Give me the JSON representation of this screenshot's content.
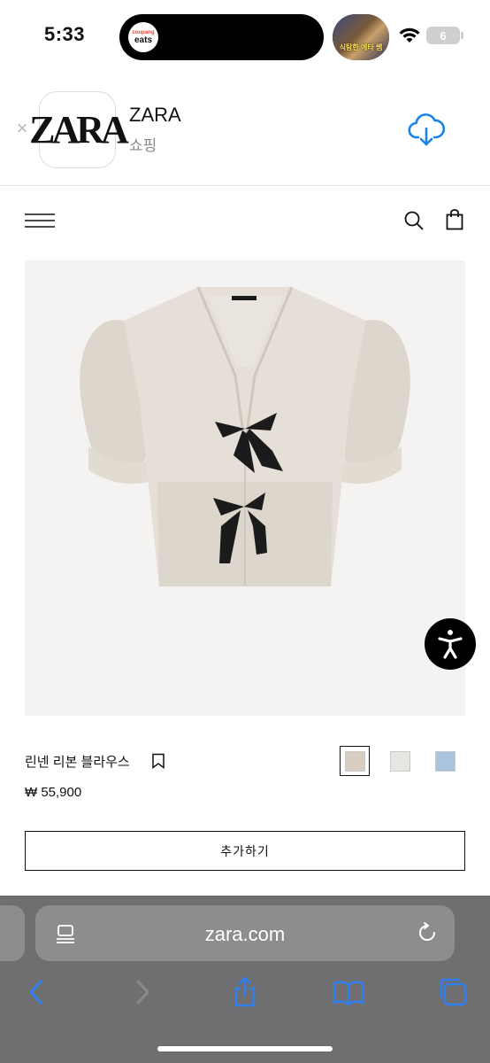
{
  "status_bar": {
    "time": "5:33",
    "island_app_line1": "coupang",
    "island_app_line2": "eats",
    "pip_caption": "식탐한 에타 쌤",
    "battery_level": "6"
  },
  "app_banner": {
    "icon_text": "ZARA",
    "app_name": "ZARA",
    "category": "쇼핑"
  },
  "product": {
    "name": "린넨 리본 블라우스",
    "price": "₩ 55,900",
    "add_button_label": "추가하기",
    "colors": [
      {
        "hex": "#d9ccc0",
        "selected": true
      },
      {
        "hex": "#e8e6e3",
        "selected": false
      },
      {
        "hex": "#aac4e0",
        "selected": false
      }
    ]
  },
  "browser": {
    "url": "zara.com"
  }
}
